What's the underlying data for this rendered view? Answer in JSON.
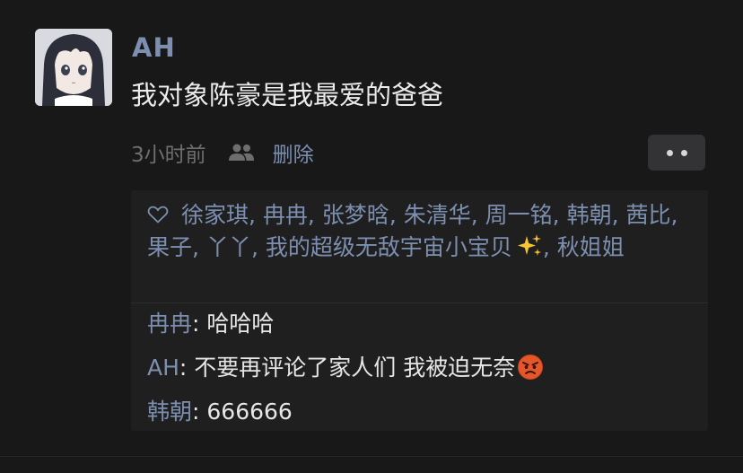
{
  "post": {
    "author": "AH",
    "text": "我对象陈豪是我最爱的爸爸",
    "time": "3小时前",
    "delete_label": "删除",
    "visibility_icon": "friends-icon",
    "more_icon": "two-dots-icon"
  },
  "likes": {
    "icon": "heart-outline-icon",
    "names": [
      "徐家琪",
      "冉冉",
      "张梦晗",
      "朱清华",
      "周一铭",
      "韩朝",
      "茜比",
      "果子",
      "丫丫",
      "我的超级无敌宇宙小宝贝",
      "秋姐姐"
    ],
    "separator": ", ",
    "emoji_after_index": 9,
    "emoji": "sparkles"
  },
  "comments": [
    {
      "author": "冉冉",
      "colon": ": ",
      "text": "哈哈哈",
      "emoji": ""
    },
    {
      "author": "AH",
      "colon": ": ",
      "text": "不要再评论了家人们 我被迫无奈",
      "emoji": "angry-face"
    },
    {
      "author": "韩朝",
      "colon": ": ",
      "text": "666666",
      "emoji": ""
    }
  ],
  "colors": {
    "background": "#181818",
    "panel": "#1f1f1f",
    "link": "#7c8fb0",
    "text": "#e6e6e6",
    "muted": "#6e6e6e"
  }
}
